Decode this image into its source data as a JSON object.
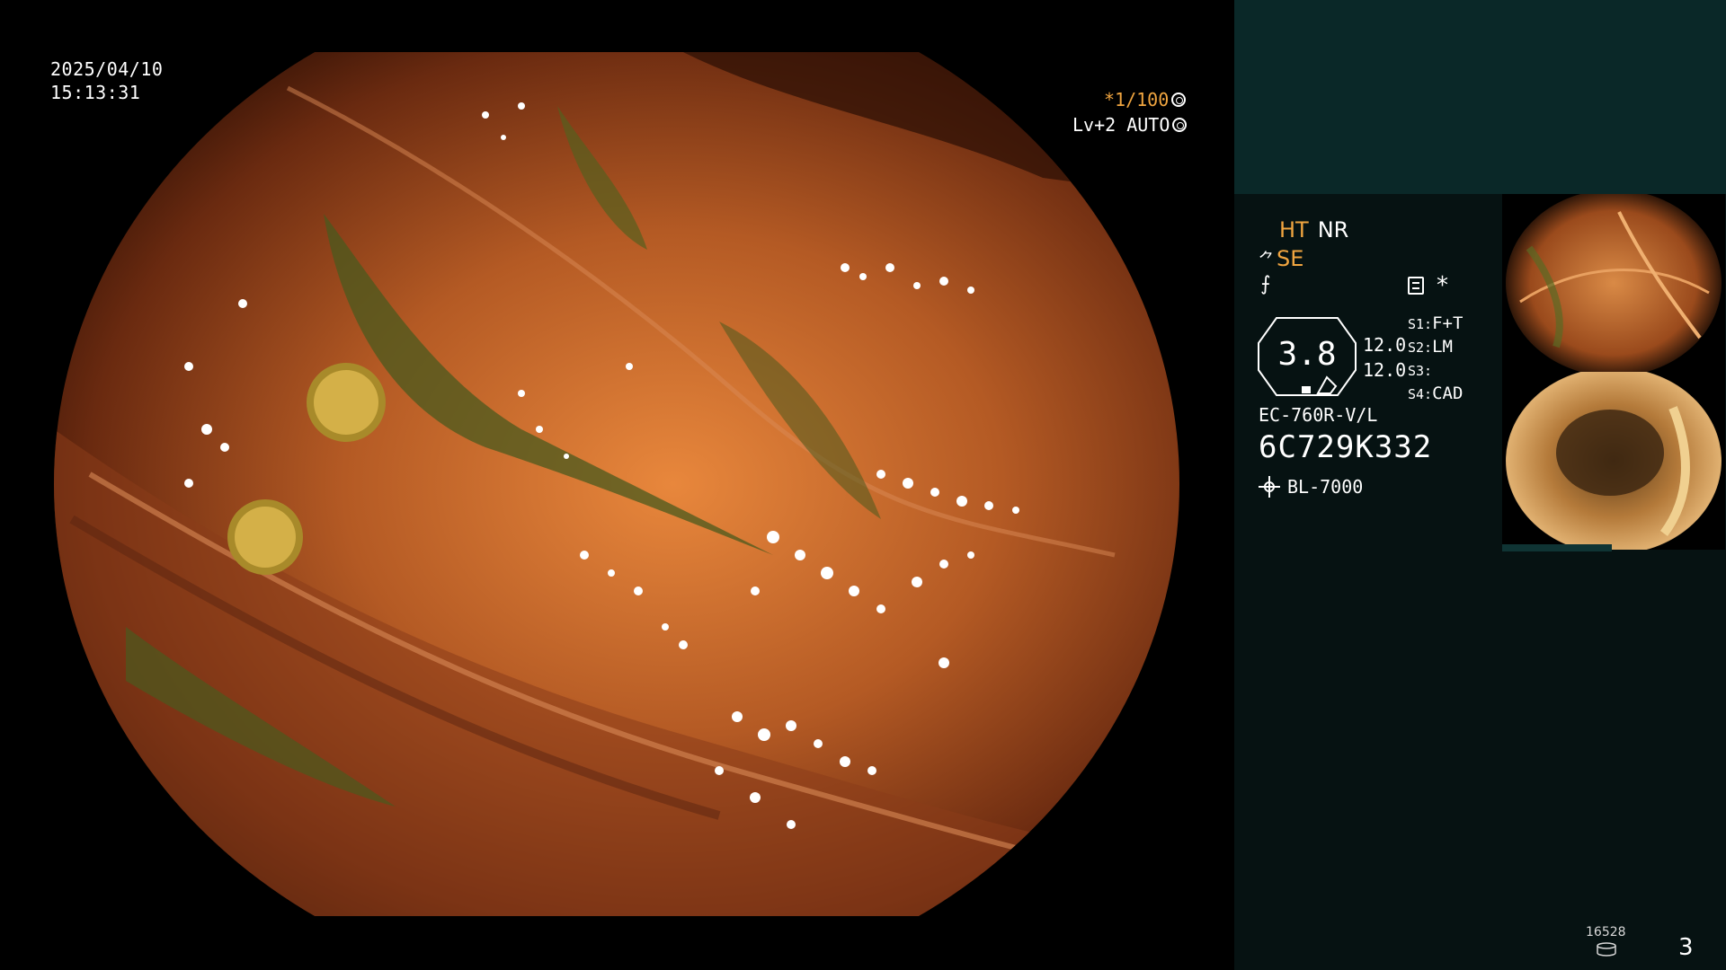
{
  "overlay": {
    "date": "2025/04/10",
    "time": "15:13:31",
    "shutter": "*1/100",
    "level": "Lv+2 AUTO"
  },
  "status": {
    "ht": "HT",
    "nr": "NR",
    "se": "SE",
    "zoom": "3.8",
    "values": [
      "12.0",
      "12.0"
    ],
    "switches": [
      {
        "key": "S1:",
        "value": "F+T"
      },
      {
        "key": "S2:",
        "value": "LM"
      },
      {
        "key": "S3:",
        "value": ""
      },
      {
        "key": "S4:",
        "value": "CAD"
      }
    ],
    "scope_model": "EC-760R-V/L",
    "scope_serial": "6C729K332",
    "light_source": "BL-7000",
    "counter": "16528",
    "page": "3"
  },
  "colors": {
    "accent": "#f0a540",
    "text": "#ffffff",
    "panel": "#061212",
    "panel_top": "#0a2828"
  }
}
